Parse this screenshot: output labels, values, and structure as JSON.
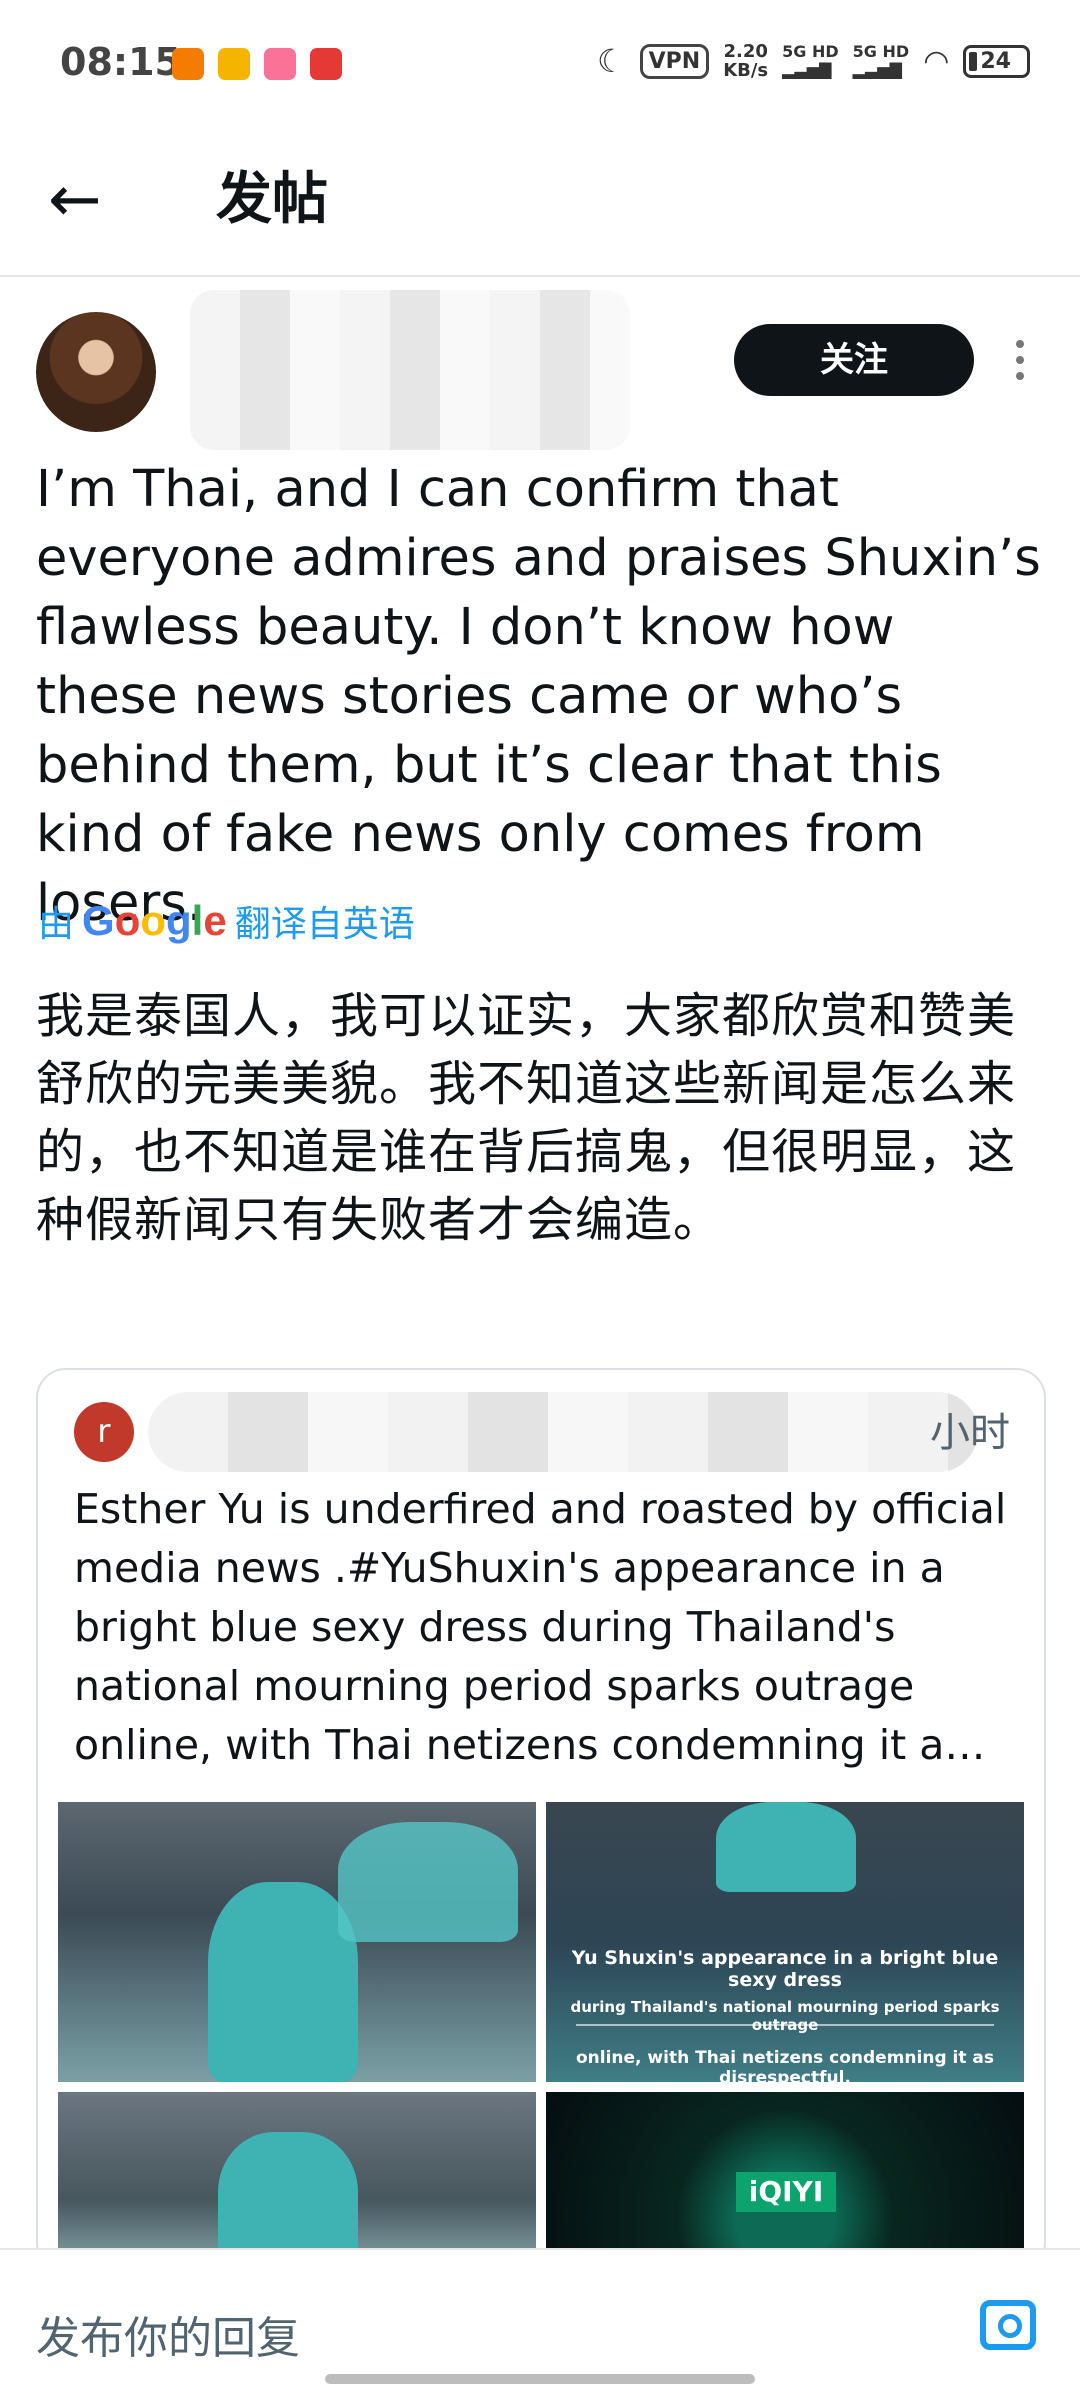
{
  "status_bar": {
    "time": "08:15",
    "vpn": "VPN",
    "speed_value": "2.20",
    "speed_unit": "KB/s",
    "signal1": "5G HD",
    "signal2": "5G HD",
    "battery": "24"
  },
  "header": {
    "title": "发帖"
  },
  "author": {
    "follow_label": "关注"
  },
  "post": {
    "text": "I’m Thai, and I can confirm that everyone admires and praises Shuxin’s flawless beauty. I don’t know how these news stories came or who’s behind them, but it’s clear that this kind of fake news only comes from losers.",
    "translate_prefix": "由",
    "translate_brand": [
      "G",
      "o",
      "o",
      "g",
      "l",
      "e"
    ],
    "translate_suffix": "翻译自英语",
    "translated_text": "我是泰国人，我可以证实，大家都欣赏和赞美舒欣的完美美貌。我不知道这些新闻是怎么来的，也不知道是谁在背后搞鬼，但很明显，这种假新闻只有失败者才会编造。"
  },
  "quoted": {
    "avatar_letter": "r",
    "time": "小时",
    "text": "Esther Yu is underfired and roasted by official media news .#YuShuxin's appearance in a bright blue sexy dress during Thailand's national mourning period sparks outrage online, with Thai netizens condemning it a…",
    "image2_caption": [
      "Yu Shuxin's appearance in a bright blue sexy dress",
      "during Thailand's national mourning period sparks outrage",
      "online, with Thai netizens condemning it as disrespectful."
    ],
    "image4_logo": "iQIYI"
  },
  "reply": {
    "placeholder": "发布你的回复"
  },
  "colors": {
    "accent": "#1d9bf0",
    "follow_bg": "#0f1419"
  }
}
